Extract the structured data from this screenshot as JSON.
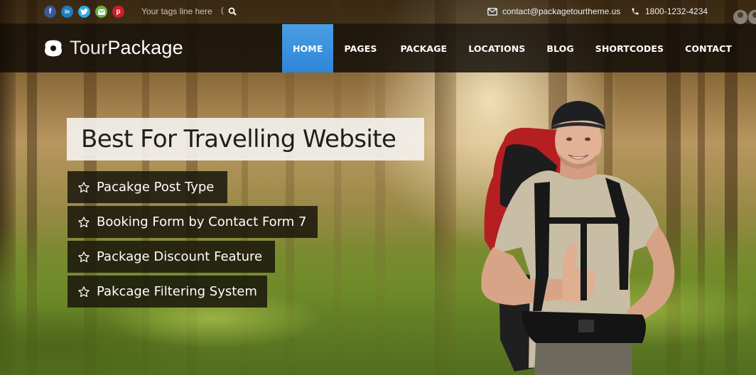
{
  "topbar": {
    "social": [
      {
        "name": "facebook",
        "glyph": "f",
        "color": "#3b5998"
      },
      {
        "name": "linkedin",
        "glyph": "in",
        "color": "#1f7bc1"
      },
      {
        "name": "twitter",
        "glyph": "t",
        "color": "#2fa9e6"
      },
      {
        "name": "email",
        "glyph": "✉",
        "color": "#6bb04a"
      },
      {
        "name": "pinterest",
        "glyph": "p",
        "color": "#cb2027"
      }
    ],
    "tagline": "Your tags line here",
    "separator": "(",
    "email": "contact@packagetourtheme.us",
    "phone": "1800-1232-4234"
  },
  "header": {
    "logo_light": "Tour",
    "logo_bold": "Package",
    "nav": [
      {
        "label": "HOME",
        "active": true
      },
      {
        "label": "PAGES",
        "active": false
      },
      {
        "label": "PACKAGE",
        "active": false
      },
      {
        "label": "LOCATIONS",
        "active": false
      },
      {
        "label": "BLOG",
        "active": false
      },
      {
        "label": "SHORTCODES",
        "active": false
      },
      {
        "label": "CONTACT",
        "active": false
      }
    ],
    "accent_color": "#3a8fdc"
  },
  "hero": {
    "headline": "Best For Travelling Website",
    "features": [
      {
        "icon": "star-outline-icon",
        "label": "Pacakge Post Type"
      },
      {
        "icon": "star-outline-icon",
        "label": "Booking Form by Contact Form 7"
      },
      {
        "icon": "star-outline-icon",
        "label": "Package Discount Feature"
      },
      {
        "icon": "star-outline-icon",
        "label": "Pakcage Filtering System"
      }
    ],
    "image_alt": "smiling hiker with backpack giving thumbs up in forest"
  }
}
